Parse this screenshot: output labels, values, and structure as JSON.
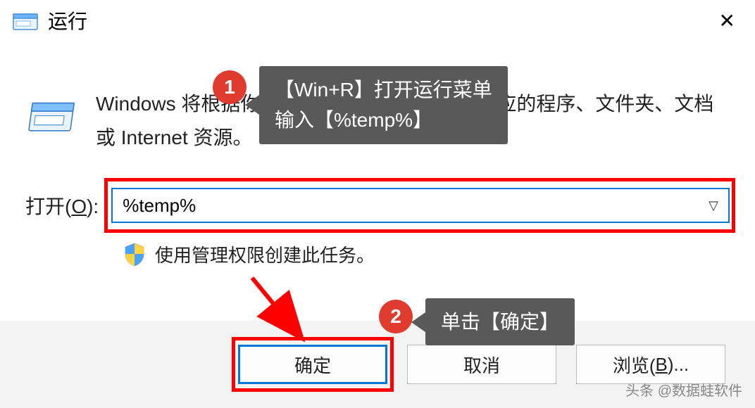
{
  "titlebar": {
    "title": "运行"
  },
  "description": "Windows 将根据你所输入的名称，为你打开相应的程序、文件夹、文档或 Internet 资源。",
  "open": {
    "label_prefix": "打开(",
    "label_key": "O",
    "label_suffix": "):",
    "value": "%temp%"
  },
  "admin_text": "使用管理权限创建此任务。",
  "buttons": {
    "ok": "确定",
    "cancel": "取消",
    "browse_prefix": "浏览(",
    "browse_key": "B",
    "browse_suffix": ")..."
  },
  "annotations": {
    "badge1": "1",
    "callout1_line1": "【Win+R】打开运行菜单",
    "callout1_line2": "输入【%temp%】",
    "badge2": "2",
    "callout2": "单击【确定】"
  },
  "watermark": "头条 @数据蛙软件"
}
